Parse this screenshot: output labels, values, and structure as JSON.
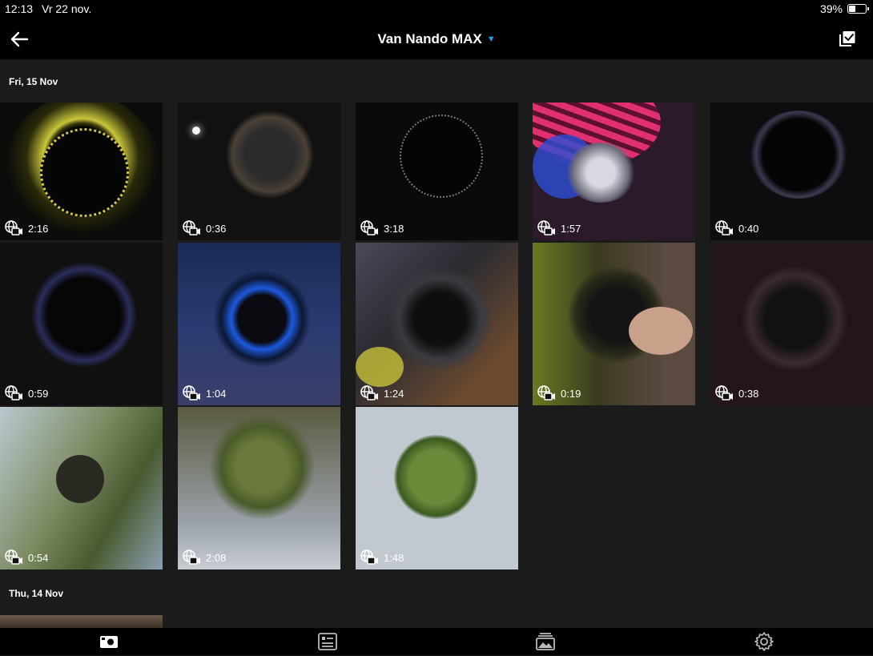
{
  "status_bar": {
    "time": "12:13",
    "date": "Vr 22 nov.",
    "battery": "39%"
  },
  "header": {
    "title": "Van Nando MAX"
  },
  "sections": [
    {
      "label": "Fri, 15 Nov"
    },
    {
      "label": "Thu, 14 Nov"
    }
  ],
  "media": [
    {
      "duration": "2:16"
    },
    {
      "duration": "0:36"
    },
    {
      "duration": "3:18"
    },
    {
      "duration": "1:57"
    },
    {
      "duration": "0:40"
    },
    {
      "duration": "0:59"
    },
    {
      "duration": "1:04"
    },
    {
      "duration": "1:24"
    },
    {
      "duration": "0:19"
    },
    {
      "duration": "0:38"
    },
    {
      "duration": "0:54"
    },
    {
      "duration": "2:08"
    },
    {
      "duration": "1:48"
    }
  ],
  "icons": {
    "back": "arrow-left-icon",
    "select": "checkbox-select-icon",
    "media_type": "360-video-icon",
    "tabs": [
      "media-icon",
      "list-icon",
      "gallery-icon",
      "gear-icon"
    ]
  },
  "colors": {
    "accent": "#2b9be8",
    "background": "#1b1b1b",
    "bar": "#000000"
  }
}
